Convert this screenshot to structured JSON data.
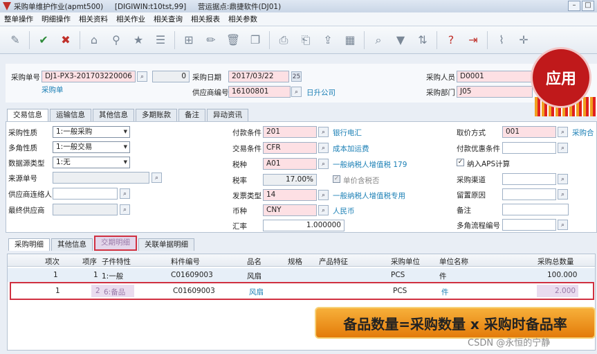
{
  "window": {
    "title": "采购单维护作业(apmt500)     [DIGIWIN:t10tst,99]     营运据点:鼎捷软件(DJ01)"
  },
  "menu": [
    "整单操作",
    "明细操作",
    "相关资料",
    "相关作业",
    "相关查询",
    "相关报表",
    "相关参数"
  ],
  "toolbar_icons": [
    "edit-icon",
    "confirm-icon",
    "cancel-icon",
    "home-icon",
    "location-icon",
    "star-icon",
    "list-icon",
    "new-icon",
    "pencil-icon",
    "delete-icon",
    "copy-icon",
    "print-icon",
    "print-preview-icon",
    "export-icon",
    "report-icon",
    "search-icon",
    "filter-icon",
    "sort-icon",
    "help-icon",
    "exit-icon",
    "attach-icon",
    "target-icon"
  ],
  "header": {
    "po_no_label": "采购单号",
    "po_no": "DJ1-PX3-201703220006",
    "seq_value": "0",
    "po_type": "采购单",
    "date_label": "采购日期",
    "date": "2017/03/22",
    "supplier_label": "供应商编号",
    "supplier": "16100801",
    "supplier_name": "日升公司",
    "buyer_label": "采购人员",
    "buyer": "D0001",
    "dept_label": "采购部门",
    "dept": "J05"
  },
  "badge": {
    "text": "应用"
  },
  "top_tabs": [
    "交易信息",
    "运输信息",
    "其他信息",
    "多期账款",
    "备注",
    "异动资讯"
  ],
  "trade": {
    "col1": [
      {
        "label": "采购性质",
        "value": "1:一般采购",
        "type": "select"
      },
      {
        "label": "多角性质",
        "value": "1:一般交易",
        "type": "select"
      },
      {
        "label": "数据源类型",
        "value": "1:无",
        "type": "select"
      },
      {
        "label": "来源单号",
        "value": "",
        "type": "lookup"
      },
      {
        "label": "供应商连络人",
        "value": "",
        "type": "lookup"
      },
      {
        "label": "最终供应商",
        "value": "",
        "type": "lookup"
      }
    ],
    "col2": [
      {
        "label": "付款条件",
        "value": "201",
        "desc": "银行电汇"
      },
      {
        "label": "交易条件",
        "value": "CFR",
        "desc": "成本加运费"
      },
      {
        "label": "税种",
        "value": "A01",
        "desc": "一般纳税人增值税 179"
      },
      {
        "label": "税率",
        "value": "17.00%",
        "desc": "单价含税否"
      },
      {
        "label": "发票类型",
        "value": "14",
        "desc": "一般纳税人增值税专用"
      },
      {
        "label": "币种",
        "value": "CNY",
        "desc": "人民币"
      },
      {
        "label": "汇率",
        "value": "1.000000",
        "desc": ""
      }
    ],
    "col3": [
      {
        "label": "取价方式",
        "value": "001",
        "desc": "采购合"
      },
      {
        "label": "付款优惠条件",
        "value": ""
      },
      {
        "label": "纳入APS计算",
        "value": "✓"
      },
      {
        "label": "采购渠道",
        "value": ""
      },
      {
        "label": "留置原因",
        "value": ""
      },
      {
        "label": "备注",
        "value": ""
      },
      {
        "label": "多角流程编号",
        "value": ""
      }
    ]
  },
  "bottom_tabs": [
    "采购明细",
    "其他信息",
    "交期明细",
    "关联单据明细"
  ],
  "grid": {
    "headers": [
      "项次",
      "项序",
      "子件特性",
      "料件编号",
      "品名",
      "规格",
      "产品特征",
      "采购单位",
      "单位名称",
      "采购总数量"
    ],
    "rows": [
      [
        "1",
        "1",
        "1:一般",
        "C01609003",
        "风扇",
        "",
        "",
        "PCS",
        "件",
        "100.000"
      ],
      [
        "1",
        "2",
        "6:备品",
        "C01609003",
        "风扇",
        "",
        "",
        "PCS",
        "件",
        "2.000"
      ]
    ]
  },
  "banner": {
    "text": "备品数量=采购数量 x 采购时备品率"
  },
  "watermark": {
    "text": "CSDN @永恒的宁静"
  }
}
